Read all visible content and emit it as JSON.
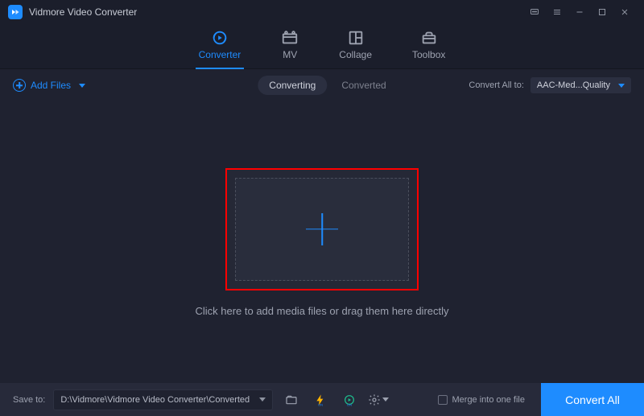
{
  "titlebar": {
    "title": "Vidmore Video Converter"
  },
  "nav": {
    "converter": "Converter",
    "mv": "MV",
    "collage": "Collage",
    "toolbox": "Toolbox"
  },
  "subbar": {
    "add_files": "Add Files",
    "converting": "Converting",
    "converted": "Converted",
    "convert_all_to_label": "Convert All to:",
    "format": "AAC-Med...Quality"
  },
  "main": {
    "drop_hint": "Click here to add media files or drag them here directly"
  },
  "bottom": {
    "save_to_label": "Save to:",
    "path": "D:\\Vidmore\\Vidmore Video Converter\\Converted",
    "merge_label": "Merge into one file",
    "convert_all": "Convert All"
  }
}
